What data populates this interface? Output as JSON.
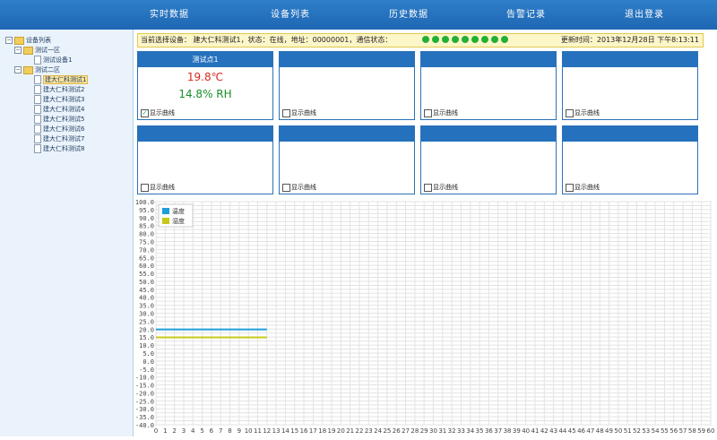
{
  "nav": {
    "items": [
      "实时数据",
      "设备列表",
      "历史数据",
      "告警记录",
      "退出登录"
    ]
  },
  "tree": {
    "root": "设备列表",
    "zone1": "测试一区",
    "zone1_devices": [
      "测试设备1"
    ],
    "zone2": "测试二区",
    "zone2_devices": [
      "建大仁科测试1",
      "建大仁科测试2",
      "建大仁科测试3",
      "建大仁科测试4",
      "建大仁科测试5",
      "建大仁科测试6",
      "建大仁科测试7",
      "建大仁科测试8"
    ],
    "selected": "建大仁科测试1"
  },
  "status": {
    "text": "当前选择设备：  建大仁科测试1，状态：在线，地址：00000001，通信状态：",
    "dots_count": 9,
    "update_time": "更新时间：2013年12月28日 下午8:13:11"
  },
  "cards": [
    {
      "title": "测试点1",
      "temp": "19.8℃",
      "hum": "14.8% RH",
      "show_curve": "显示曲线",
      "checked": true
    },
    {
      "title": "",
      "temp": "",
      "hum": "",
      "show_curve": "显示曲线",
      "checked": false
    },
    {
      "title": "",
      "temp": "",
      "hum": "",
      "show_curve": "显示曲线",
      "checked": false
    },
    {
      "title": "",
      "temp": "",
      "hum": "",
      "show_curve": "显示曲线",
      "checked": false
    },
    {
      "title": "",
      "temp": "",
      "hum": "",
      "show_curve": "显示曲线",
      "checked": false
    },
    {
      "title": "",
      "temp": "",
      "hum": "",
      "show_curve": "显示曲线",
      "checked": false
    },
    {
      "title": "",
      "temp": "",
      "hum": "",
      "show_curve": "显示曲线",
      "checked": false
    },
    {
      "title": "",
      "temp": "",
      "hum": "",
      "show_curve": "显示曲线",
      "checked": false
    }
  ],
  "colors": {
    "temp_series": "#1e9ed8",
    "hum_series": "#c8c81a",
    "nav_bg": "#2f7fc9"
  },
  "chart_data": {
    "type": "line",
    "ylim": [
      -40,
      100
    ],
    "xlim": [
      0,
      60
    ],
    "y_ticks": [
      "100.0",
      "95.0",
      "90.0",
      "85.0",
      "80.0",
      "75.0",
      "70.0",
      "65.0",
      "60.0",
      "55.0",
      "50.0",
      "45.0",
      "40.0",
      "35.0",
      "30.0",
      "25.0",
      "20.0",
      "15.0",
      "10.0",
      "5.0",
      "0.0",
      "-5.0",
      "-10.0",
      "-15.0",
      "-20.0",
      "-25.0",
      "-30.0",
      "-35.0",
      "-40.0"
    ],
    "x_ticks": [
      "0",
      "1",
      "2",
      "3",
      "4",
      "5",
      "6",
      "7",
      "8",
      "9",
      "10",
      "11",
      "12",
      "13",
      "14",
      "15",
      "16",
      "17",
      "18",
      "19",
      "20",
      "21",
      "22",
      "23",
      "24",
      "25",
      "26",
      "27",
      "28",
      "29",
      "30",
      "31",
      "32",
      "33",
      "34",
      "35",
      "36",
      "37",
      "38",
      "39",
      "40",
      "41",
      "42",
      "43",
      "44",
      "45",
      "46",
      "47",
      "48",
      "49",
      "50",
      "51",
      "52",
      "53",
      "54",
      "55",
      "56",
      "57",
      "58",
      "59",
      "60"
    ],
    "grid": true,
    "legend": "top-left",
    "series": [
      {
        "name": "温度",
        "x": [
          0,
          1,
          2,
          3,
          4,
          5,
          6,
          7,
          8,
          9,
          10,
          11,
          12
        ],
        "values": [
          19.8,
          19.8,
          19.8,
          19.8,
          19.8,
          19.8,
          19.8,
          19.8,
          19.8,
          19.8,
          19.8,
          19.8,
          19.8
        ]
      },
      {
        "name": "湿度",
        "x": [
          0,
          1,
          2,
          3,
          4,
          5,
          6,
          7,
          8,
          9,
          10,
          11,
          12
        ],
        "values": [
          14.8,
          14.8,
          14.8,
          14.8,
          14.8,
          14.8,
          14.8,
          14.8,
          14.8,
          14.8,
          14.8,
          14.8,
          14.8
        ]
      }
    ]
  }
}
